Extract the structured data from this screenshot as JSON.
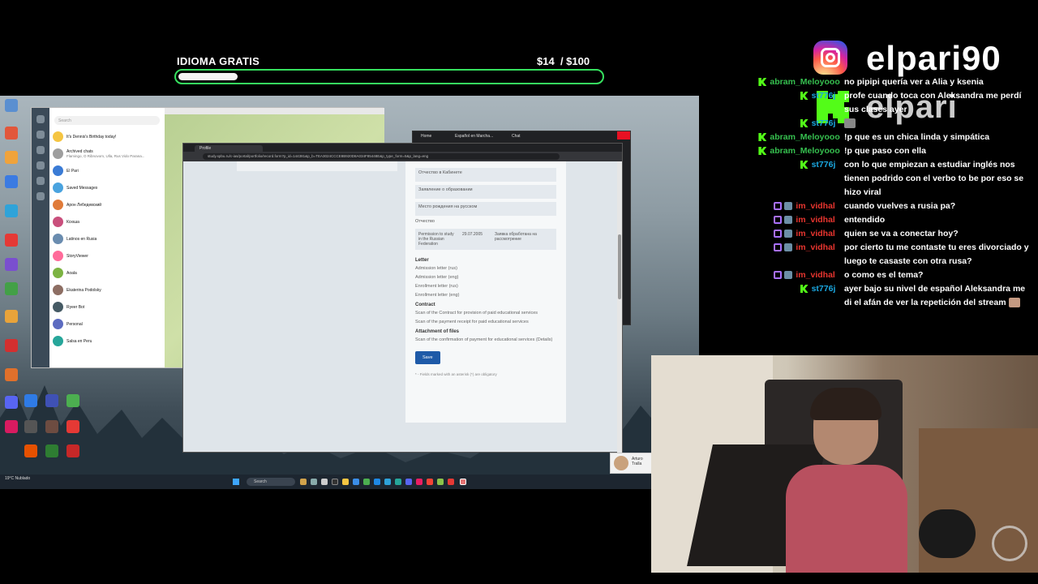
{
  "goal": {
    "title": "IDIOMA GRATIS",
    "current": "$14",
    "target": "/ $100",
    "progress_fraction": 0.14
  },
  "branding": {
    "instagram_handle": "elpari90",
    "kick_handle": "elpari"
  },
  "desktop": {
    "telegram": {
      "search_placeholder": "Search",
      "chats": [
        {
          "name": "It's Dennis's Birthday today!",
          "preview": ""
        },
        {
          "name": "Archived chats",
          "preview": "Flamingo, O Ribnovom, Ulla, Rus Vido Parana..."
        },
        {
          "name": "El Pari",
          "preview": ""
        },
        {
          "name": "Saved Messages",
          "preview": ""
        },
        {
          "name": "Арон Лебедевский",
          "preview": ""
        },
        {
          "name": "Ксюша",
          "preview": ""
        },
        {
          "name": "Latinos en Rusia",
          "preview": ""
        },
        {
          "name": "StoryViewer",
          "preview": ""
        },
        {
          "name": "Aoala",
          "preview": ""
        },
        {
          "name": "Ekaterina Podolsky",
          "preview": ""
        },
        {
          "name": "Ryeer Bot",
          "preview": ""
        },
        {
          "name": "Personal",
          "preview": ""
        },
        {
          "name": "Salsa en Peru",
          "preview": ""
        }
      ]
    },
    "browser_back": {
      "tabs": [
        "Home",
        "Español en Marcha...",
        "Chat"
      ]
    },
    "browser": {
      "tab": "Profile",
      "url": "study.spbu.ru/c-ias/portal/portfolio/record.form?p_id=144381&p_b=TEA3024CCCE8B920D8A034F85448E&p_type_form=5&p_lang=eng",
      "form": {
        "fields": [
          "Отчество в Кабинете",
          "Заявление о образовании",
          "Место рождения на русском",
          "Отчество"
        ],
        "permission": {
          "label": "Permission to study in the Russian Federation",
          "date": "29.07.2005",
          "value": "Заявка обработана на рассмотрение"
        },
        "letter_heading": "Letter",
        "letter_items": [
          "Admission letter (rus)",
          "Admission letter (eng)",
          "Enrollment letter (rus)",
          "Enrollment letter (eng)"
        ],
        "contract_heading": "Contract",
        "contract_items": [
          "Scan of the Contract for provision of paid educational services",
          "Scan of the payment receipt for paid educational services"
        ],
        "attachment_heading": "Attachment of files",
        "attachment_items": [
          "Scan of the confirmation of payment for educational services (Details)"
        ],
        "save_button": "Save",
        "note": "* - Fields marked with an asterisk (*) are obligatory"
      }
    },
    "taskbar": {
      "weather": "19°C Nublado",
      "search": "Search",
      "clock": ""
    },
    "notification": {
      "name": "Arturo Tralla"
    }
  },
  "chat": [
    {
      "badges": [
        "kick"
      ],
      "user": "abram_Meloyooo",
      "color": "#36c04f",
      "text": "no pipipi quería ver a Alia y ksenia"
    },
    {
      "badges": [
        "kick"
      ],
      "user": "st776j",
      "color": "#1aa7e0",
      "text": "profe cuando toca con Aleksandra me perdí sus clases ayer"
    },
    {
      "badges": [
        "kick"
      ],
      "user": "st776j",
      "color": "#1aa7e0",
      "text": ""
    },
    {
      "badges": [
        "kick"
      ],
      "user": "abram_Meloyooo",
      "color": "#36c04f",
      "text": "!p que es un chica linda y simpática"
    },
    {
      "badges": [
        "kick"
      ],
      "user": "abram_Meloyooo",
      "color": "#36c04f",
      "text": "!p que paso con ella"
    },
    {
      "badges": [
        "kick"
      ],
      "user": "st776j",
      "color": "#1aa7e0",
      "text": "con lo que empiezan a estudiar inglés nos tienen podrido con el verbo to be por eso se hizo viral"
    },
    {
      "badges": [
        "sq",
        "sq2"
      ],
      "user": "im_vidhal",
      "color": "#e8352f",
      "text": "cuando vuelves a rusia pa?"
    },
    {
      "badges": [
        "sq",
        "sq2"
      ],
      "user": "im_vidhal",
      "color": "#e8352f",
      "text": "entendido"
    },
    {
      "badges": [
        "sq",
        "sq2"
      ],
      "user": "im_vidhal",
      "color": "#e8352f",
      "text": "quien se va a conectar hoy?"
    },
    {
      "badges": [
        "sq",
        "sq2"
      ],
      "user": "im_vidhal",
      "color": "#e8352f",
      "text": "por cierto tu me contaste tu eres divorciado y luego te casaste con otra rusa?"
    },
    {
      "badges": [
        "sq",
        "sq2"
      ],
      "user": "im_vidhal",
      "color": "#e8352f",
      "text": "o como es el tema?"
    },
    {
      "badges": [
        "kick"
      ],
      "user": "st776j",
      "color": "#1aa7e0",
      "text": "ayer bajo su nivel de español Aleksandra me di el afán de ver la repetición del stream"
    }
  ]
}
